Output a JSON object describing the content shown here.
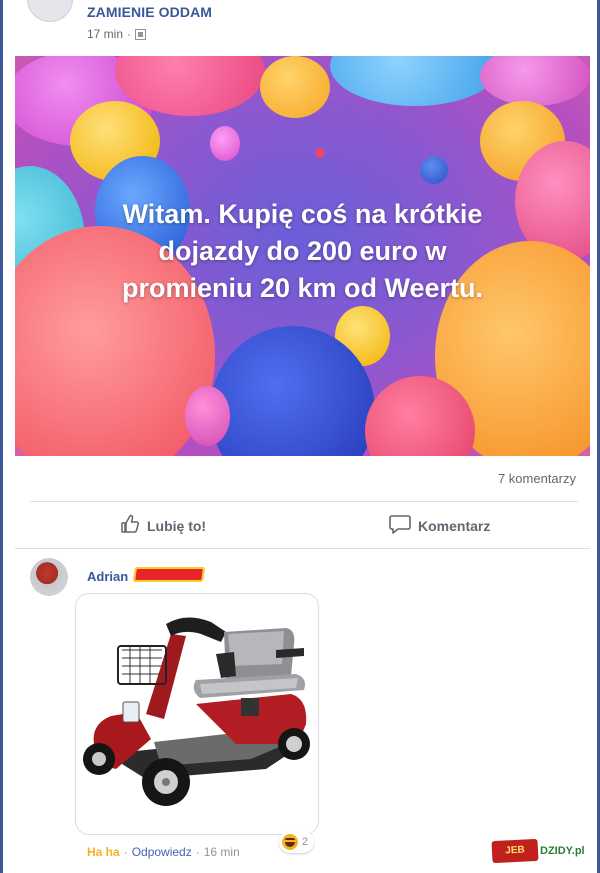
{
  "post": {
    "group_name": "ZAMIENIE ODDAM",
    "time": "17 min",
    "meta_separator": "·",
    "audience_icon": "group-audience-icon",
    "text_line1": "Witam. Kupię coś na krótkie",
    "text_line2": "dojazdy do 200 euro w",
    "text_line3": "promieniu 20 km od Weertu.",
    "comment_count": "7 komentarzy"
  },
  "actions": {
    "like_label": "Lubię to!",
    "comment_label": "Komentarz"
  },
  "comment": {
    "author": "Adrian",
    "haha_label": "Ha ha",
    "separator": "·",
    "reply_label": "Odpowiedz",
    "time": "16 min",
    "reaction_count": "2",
    "attachment_icon": "mobility-scooter-image"
  },
  "watermark": {
    "left": "JEB",
    "right": "DZIDY.pl"
  },
  "colors": {
    "link_blue": "#385898",
    "haha_yellow": "#f7b125",
    "facebook_blue": "#3b5998"
  }
}
